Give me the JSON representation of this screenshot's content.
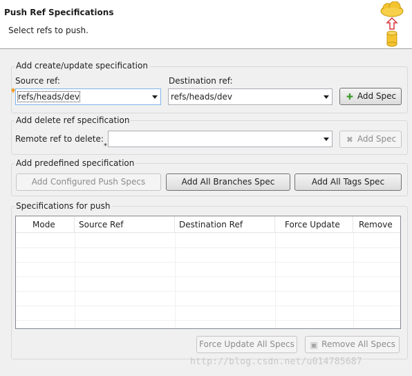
{
  "header": {
    "title": "Push Ref Specifications",
    "subtitle": "Select refs to push."
  },
  "create_group": {
    "label": "Add create/update specification",
    "source_label": "Source ref:",
    "source_value": "refs/heads/dev",
    "dest_label": "Destination ref:",
    "dest_value": "refs/heads/dev",
    "add_spec": "Add Spec"
  },
  "delete_group": {
    "label": "Add delete ref specification",
    "remote_label": "Remote ref to delete:",
    "remote_value": "",
    "add_spec": "Add Spec"
  },
  "predefined_group": {
    "label": "Add predefined specification",
    "configured": "Add Configured Push Specs",
    "all_branches": "Add All Branches Spec",
    "all_tags": "Add All Tags Spec"
  },
  "specs_group": {
    "label": "Specifications for push",
    "columns": [
      "Mode",
      "Source Ref",
      "Destination Ref",
      "Force Update",
      "Remove"
    ],
    "force_update_all": "Force Update All Specs",
    "remove_all": "Remove All Specs"
  },
  "watermark": "http://blog.csdn.net/u014785687",
  "colors": {
    "add_icon": "#3c9a2a",
    "cloud": "#f4c430",
    "arrow": "#d9343a"
  }
}
